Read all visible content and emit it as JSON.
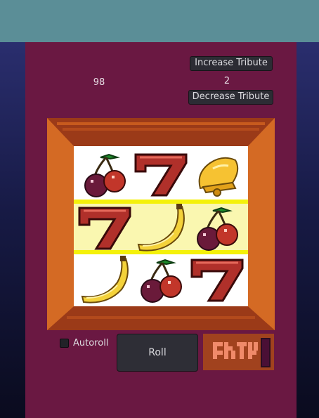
{
  "money": "98",
  "tribute": {
    "increase_label": "Increase Tribute",
    "decrease_label": "Decrease Tribute",
    "value": "2"
  },
  "controls": {
    "autoroll_label": "Autoroll",
    "autoroll_checked": false,
    "roll_label": "Roll"
  },
  "reels": {
    "rows": [
      [
        "cherry",
        "seven",
        "bell"
      ],
      [
        "seven",
        "banana",
        "cherry"
      ],
      [
        "banana",
        "cherry",
        "seven"
      ]
    ],
    "highlighted_row": 1
  },
  "colors": {
    "top_bar": "#5b8e97",
    "panel": "#6a1842",
    "machine_frame": "#c5581e",
    "win_line": "#f4f10a"
  }
}
